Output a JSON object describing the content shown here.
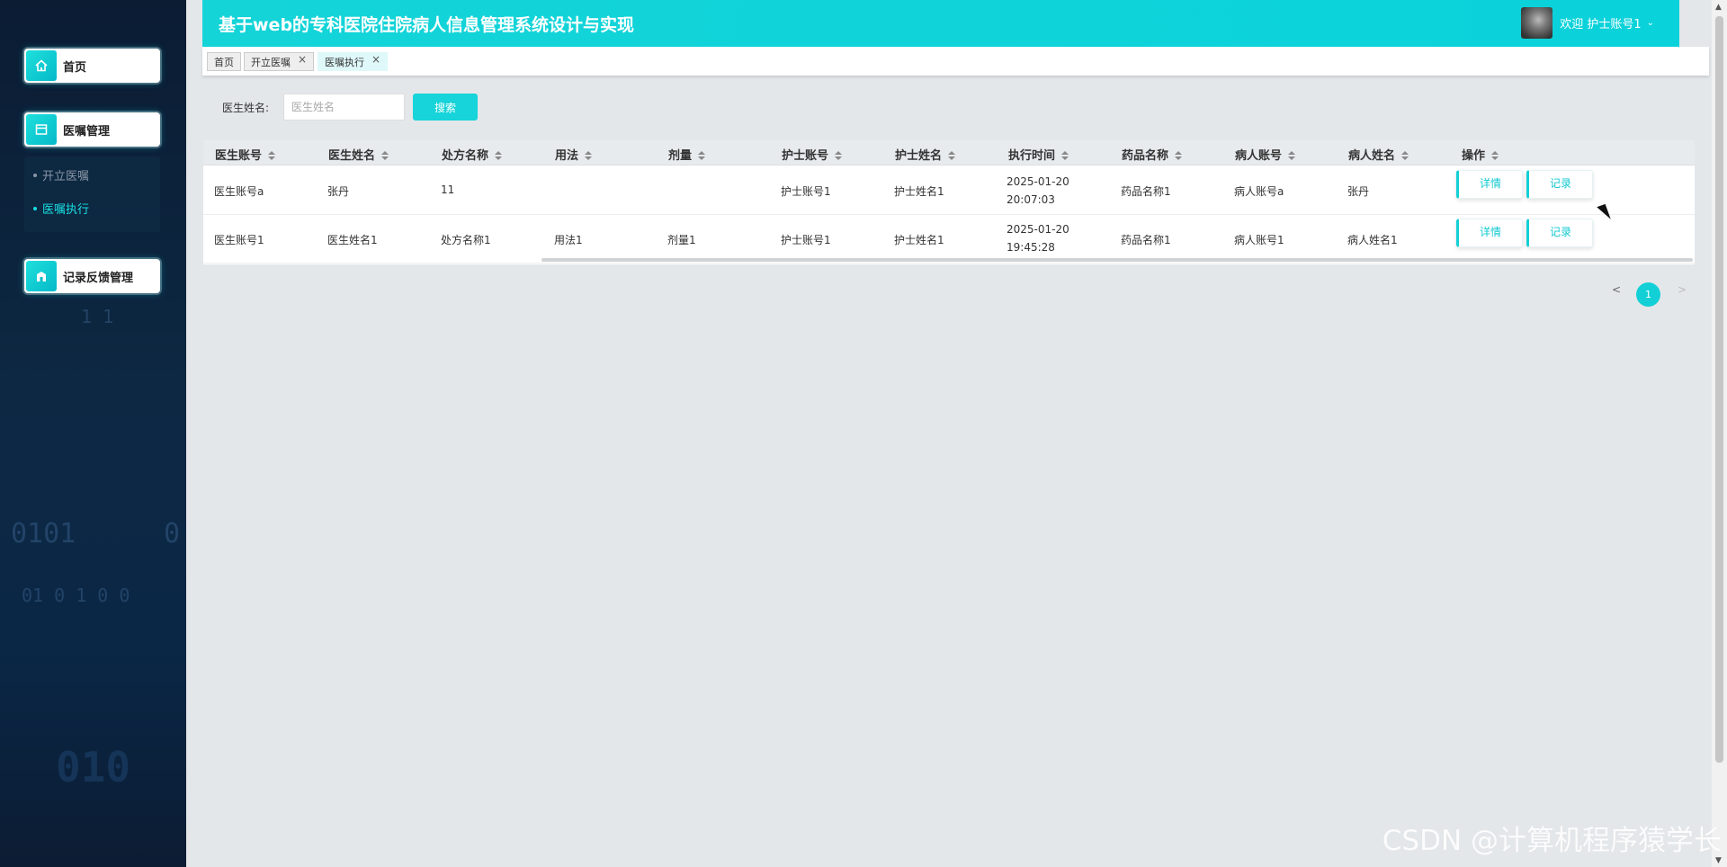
{
  "app": {
    "title": "基于web的专科医院住院病人信息管理系统设计与实现",
    "welcome": "欢迎 护士账号1"
  },
  "sidebar": {
    "home": "首页",
    "orders": "医嘱管理",
    "orders_sub": [
      "开立医嘱",
      "医嘱执行"
    ],
    "feedback": "记录反馈管理",
    "deco": [
      "1 1",
      "0101",
      "0",
      "01  0  1  0  0",
      "010"
    ]
  },
  "tabs": [
    "首页",
    "开立医嘱",
    "医嘱执行"
  ],
  "search": {
    "label": "医生姓名:",
    "placeholder": "医生姓名",
    "button": "搜索"
  },
  "table": {
    "columns": [
      "医生账号",
      "医生姓名",
      "处方名称",
      "用法",
      "剂量",
      "护士账号",
      "护士姓名",
      "执行时间",
      "药品名称",
      "病人账号",
      "病人姓名",
      "操作"
    ],
    "rows": [
      [
        "医生账号a",
        "张丹",
        "11",
        "",
        "",
        "护士账号1",
        "护士姓名1",
        "2025-01-20 20:07:03",
        "药品名称1",
        "病人账号a",
        "张丹"
      ],
      [
        "医生账号1",
        "医生姓名1",
        "处方名称1",
        "用法1",
        "剂量1",
        "护士账号1",
        "护士姓名1",
        "2025-01-20 19:45:28",
        "药品名称1",
        "病人账号1",
        "病人姓名1"
      ]
    ],
    "actions": [
      "详情",
      "记录"
    ]
  },
  "pagination": {
    "prev": "<",
    "current": "1",
    "next": ">"
  },
  "watermark": "CSDN @计算机程序猿学长",
  "colors": {
    "accent": "#13d0d6",
    "sidebar": "#0d2843",
    "header": "#14d4d8"
  },
  "icons": {
    "home": "home-icon",
    "orders": "document-icon",
    "feedback": "building-icon"
  }
}
